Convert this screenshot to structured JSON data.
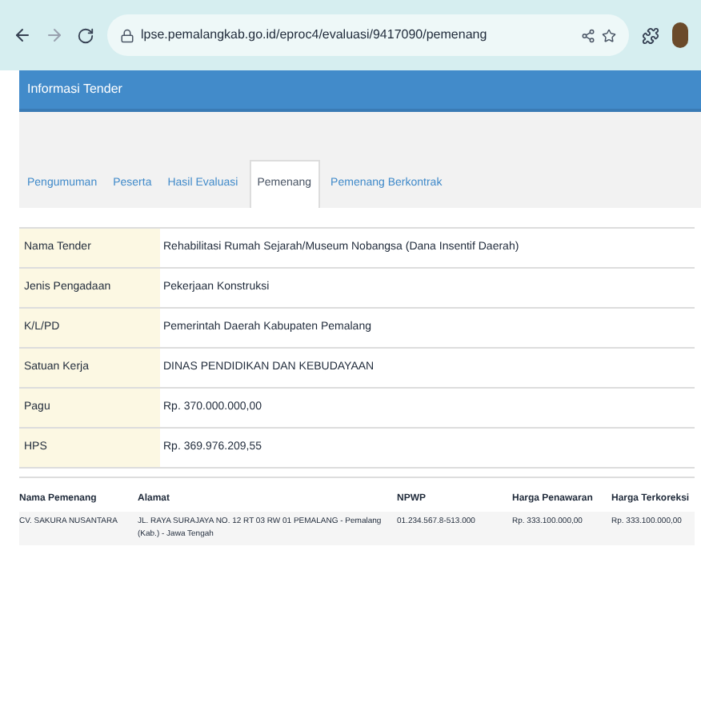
{
  "browser": {
    "url": "lpse.pemalangkab.go.id/eproc4/evaluasi/9417090/pemenang"
  },
  "header": {
    "title": "Informasi Tender"
  },
  "tabs": [
    {
      "label": "Pengumuman",
      "selected": false
    },
    {
      "label": "Peserta",
      "selected": false
    },
    {
      "label": "Hasil Evaluasi",
      "selected": false
    },
    {
      "label": "Pemenang",
      "selected": true
    },
    {
      "label": "Pemenang Berkontrak",
      "selected": false
    }
  ],
  "details": [
    {
      "label": "Nama Tender",
      "value": "Rehabilitasi Rumah Sejarah/Museum Nobangsa (Dana Insentif Daerah)"
    },
    {
      "label": "Jenis Pengadaan",
      "value": "Pekerjaan Konstruksi"
    },
    {
      "label": "K/L/PD",
      "value": "Pemerintah Daerah Kabupaten Pemalang"
    },
    {
      "label": "Satuan Kerja",
      "value": "DINAS PENDIDIKAN DAN KEBUDAYAAN"
    },
    {
      "label": "Pagu",
      "value": "Rp. 370.000.000,00"
    },
    {
      "label": "HPS",
      "value": "Rp. 369.976.209,55"
    }
  ],
  "winners": {
    "columns": [
      "Nama Pemenang",
      "Alamat",
      "NPWP",
      "Harga Penawaran",
      "Harga Terkoreksi"
    ],
    "rows": [
      [
        "CV. SAKURA NUSANTARA",
        "JL. RAYA SURAJAYA NO. 12 RT 03 RW 01 PEMALANG - Pemalang (Kab.) - Jawa Tengah",
        "01.234.567.8-513.000",
        "Rp. 333.100.000,00",
        "Rp. 333.100.000,00"
      ]
    ]
  }
}
